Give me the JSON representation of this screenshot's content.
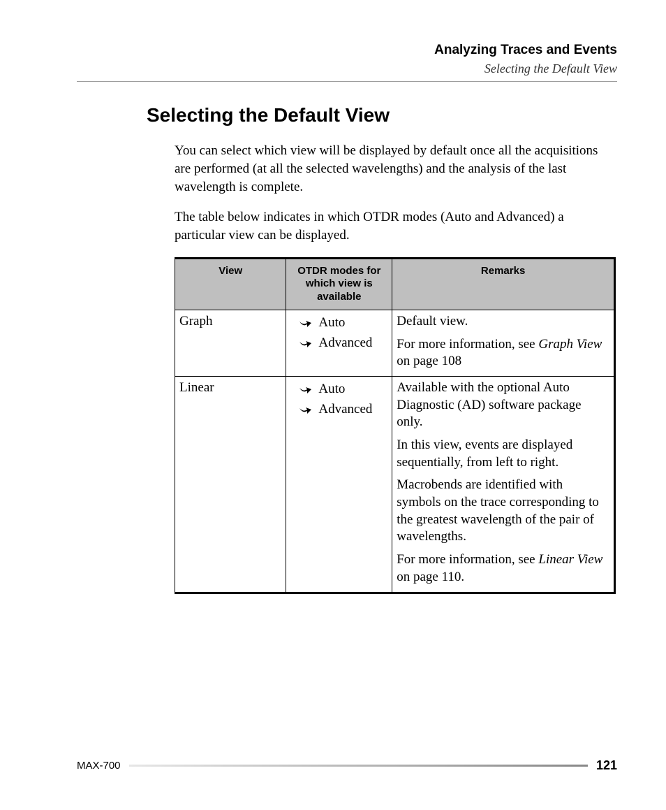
{
  "header": {
    "chapter_title": "Analyzing Traces and Events",
    "section_sub": "Selecting the Default View"
  },
  "section": {
    "heading": "Selecting the Default View",
    "para1": "You can select which view will be displayed by default once all the acquisitions are performed (at all the selected wavelengths) and the analysis of the last wavelength is complete.",
    "para2": "The table below indicates in which OTDR modes (Auto and Advanced) a particular view can be displayed."
  },
  "table": {
    "headers": {
      "view": "View",
      "modes": "OTDR modes for which view is available",
      "remarks": "Remarks"
    },
    "rows": [
      {
        "view": "Graph",
        "modes": [
          "Auto",
          "Advanced"
        ],
        "remarks": {
          "r1": "Default view.",
          "r2_pre": "For more information, see ",
          "r2_ital": "Graph View",
          "r2_post": " on page 108"
        }
      },
      {
        "view": "Linear",
        "modes": [
          "Auto",
          "Advanced"
        ],
        "remarks": {
          "r1": "Available with the optional Auto Diagnostic (AD) software package only.",
          "r2": "In this view, events are displayed sequentially, from left to right.",
          "r3": "Macrobends are identified with symbols on the trace corresponding to the greatest wavelength of the pair of wavelengths.",
          "r4_pre": "For more information, see ",
          "r4_ital": "Linear View",
          "r4_post": " on page 110."
        }
      }
    ]
  },
  "footer": {
    "model": "MAX-700",
    "page": "121"
  }
}
